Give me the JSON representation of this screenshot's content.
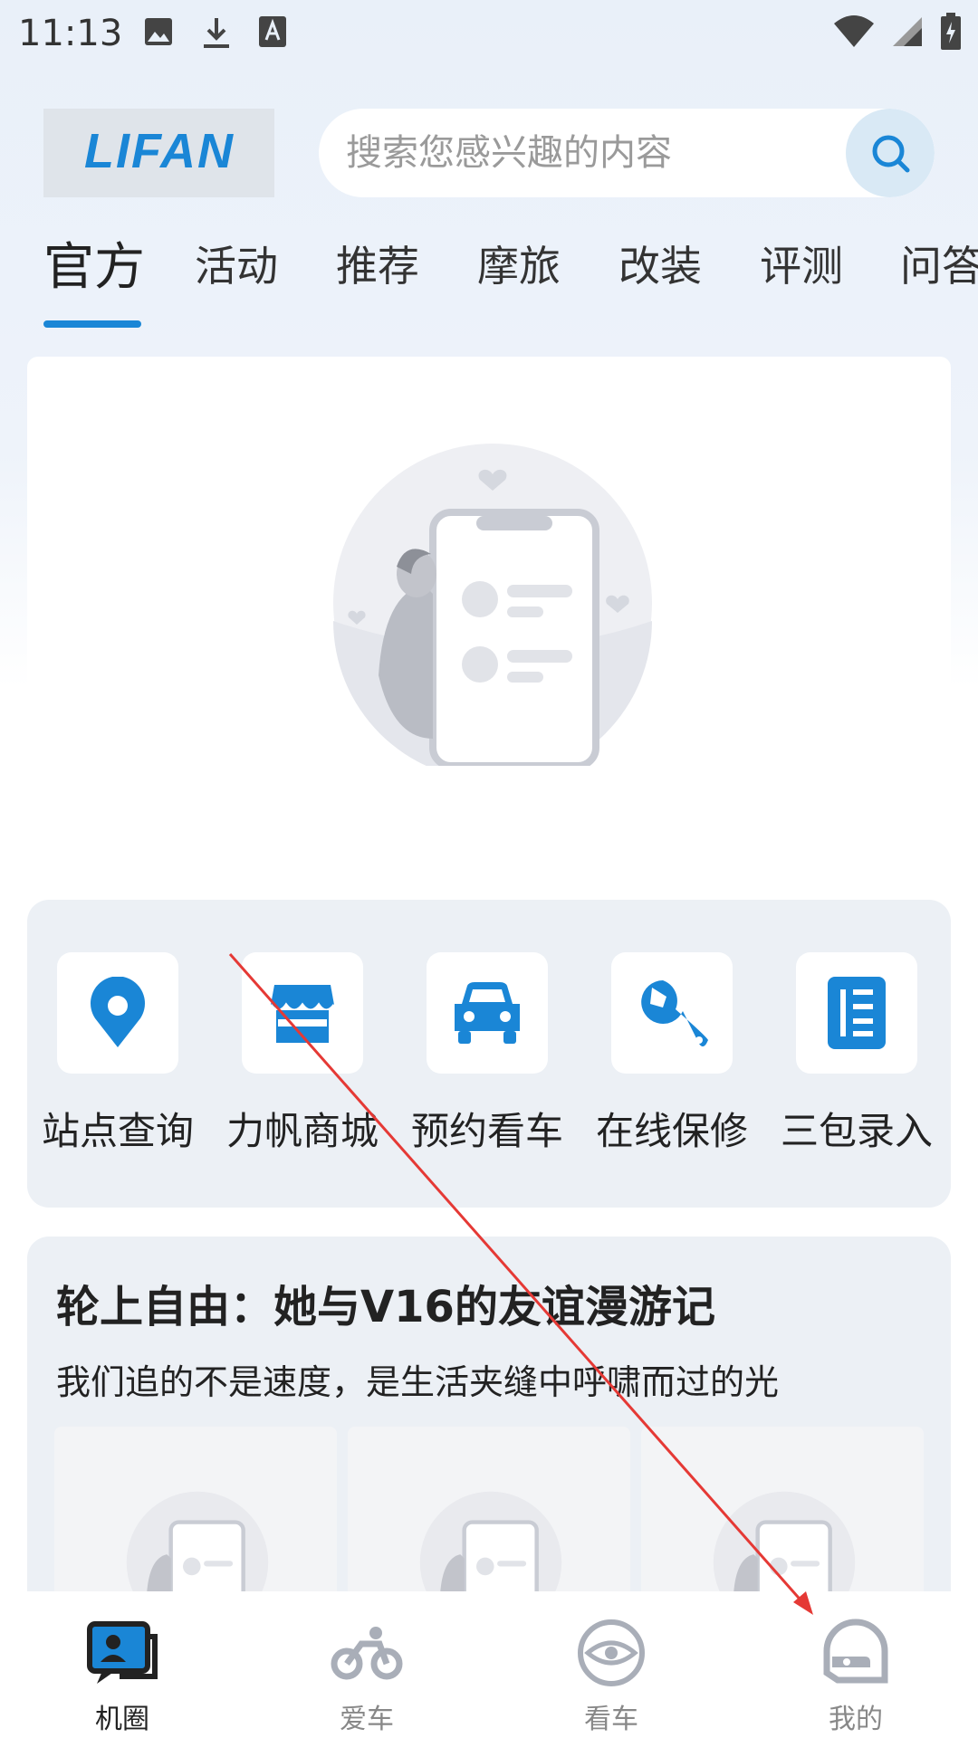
{
  "status_bar": {
    "time": "11:13",
    "left_icons": [
      "image-icon",
      "download-icon",
      "font-icon"
    ],
    "right_icons": [
      "wifi-icon",
      "cellular-signal-icon",
      "battery-charging-icon"
    ]
  },
  "header": {
    "logo_text": "LIFAN",
    "search": {
      "placeholder": "搜索您感兴趣的内容",
      "icon": "search-icon"
    }
  },
  "tabs": [
    {
      "label": "官方",
      "active": true
    },
    {
      "label": "活动"
    },
    {
      "label": "推荐"
    },
    {
      "label": "摩旅"
    },
    {
      "label": "改装"
    },
    {
      "label": "评测"
    },
    {
      "label": "问答"
    }
  ],
  "banner": {
    "icon": "empty-content-placeholder-icon"
  },
  "quick_actions": [
    {
      "label": "站点查询",
      "icon": "location-pin-icon"
    },
    {
      "label": "力帆商城",
      "icon": "store-icon"
    },
    {
      "label": "预约看车",
      "icon": "car-icon"
    },
    {
      "label": "在线保修",
      "icon": "wrench-icon"
    },
    {
      "label": "三包录入",
      "icon": "document-icon"
    }
  ],
  "article": {
    "title": "轮上自由：她与V16的友谊漫游记",
    "subtitle": "我们追的不是速度，是生活夹缝中呼啸而过的光"
  },
  "bottom_nav": [
    {
      "label": "机圈",
      "icon": "chat-circle-icon",
      "active": true
    },
    {
      "label": "爱车",
      "icon": "motorcycle-icon"
    },
    {
      "label": "看车",
      "icon": "eye-icon"
    },
    {
      "label": "我的",
      "icon": "helmet-icon"
    }
  ],
  "colors": {
    "accent": "#1a86d6",
    "annotation_arrow": "#e53935"
  }
}
